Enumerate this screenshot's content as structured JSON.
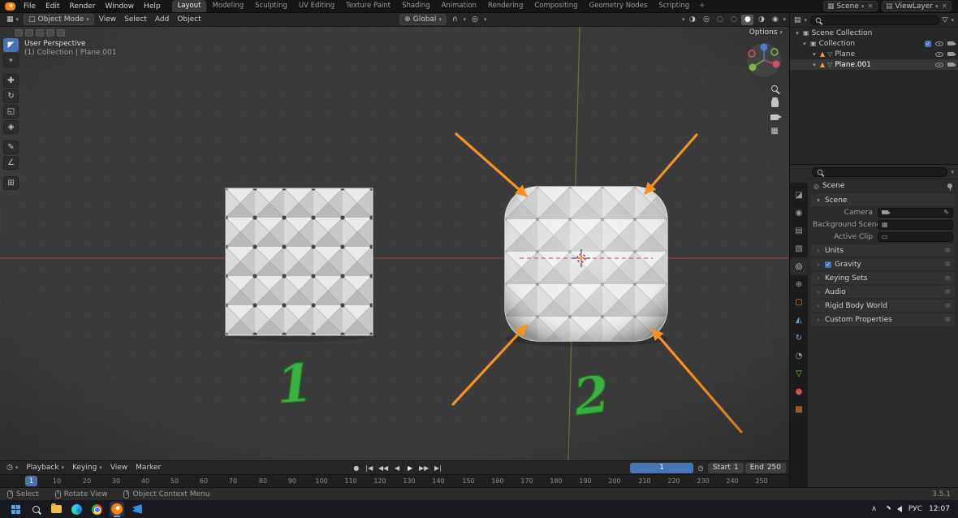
{
  "colors": {
    "accent_blue": "#4772b3",
    "arrow_orange": "#f7931e",
    "annotation_green": "#3cb043",
    "viewport_bg": "#3b3b3b"
  },
  "icons": {
    "dropdown": "▾",
    "close": "×",
    "expander_open": "▾",
    "collapsed": "›",
    "grid": "▦",
    "globe": "⊕",
    "magnet": "∩",
    "proportional": "◎",
    "wireframe": "◌",
    "solid": "●",
    "material_preview": "◑",
    "rendered": "◉",
    "record": "●",
    "jump_start": "|◀",
    "prev_key": "◀◀",
    "play_back": "◀",
    "play": "▶",
    "next_key": "▶▶",
    "jump_end": "▶|",
    "clock": "◷",
    "menu_lines": "≡",
    "check": "✓",
    "pencil": "✎",
    "scene": "◎",
    "viewlayer": "▤",
    "editor_outliner": "▤",
    "filter": "▽",
    "tray_chevron": "∧",
    "mesh_object": "▲",
    "mesh_data": "▽",
    "collection": "▣",
    "field_scene": "▦",
    "field_clip": "▭",
    "tools": [
      "◤",
      "⌖",
      "✚",
      "↻",
      "◱",
      "◈",
      "✎",
      "∠",
      "⊞"
    ],
    "ptabs": [
      "◪",
      "◉",
      "▤",
      "▧",
      "◎",
      "⊕",
      "▢",
      "◭",
      "↻",
      "◔",
      "▽",
      "●",
      "▩"
    ]
  },
  "topbar": {
    "menus": [
      "File",
      "Edit",
      "Render",
      "Window",
      "Help"
    ],
    "workspaces": [
      "Layout",
      "Modeling",
      "Sculpting",
      "UV Editing",
      "Texture Paint",
      "Shading",
      "Animation",
      "Rendering",
      "Compositing",
      "Geometry Nodes",
      "Scripting"
    ],
    "new_workspace": "+",
    "scene": "Scene",
    "viewlayer": "ViewLayer"
  },
  "viewport_header": {
    "mode": "Object Mode",
    "menus": [
      "View",
      "Select",
      "Add",
      "Object"
    ],
    "orientation": "Global",
    "options": "Options"
  },
  "viewport": {
    "perspective": "User Perspective",
    "context": "(1) Collection | Plane.001",
    "label_1": "1",
    "label_2": "2"
  },
  "outliner": {
    "scene_collection": "Scene Collection",
    "collection": "Collection",
    "plane": "Plane",
    "plane001": "Plane.001"
  },
  "properties": {
    "breadcrumb": "Scene",
    "scene_section": "Scene",
    "camera": "Camera",
    "background_scene": "Background Scene",
    "active_clip": "Active Clip",
    "sections": [
      "Units",
      "Gravity",
      "Keying Sets",
      "Audio",
      "Rigid Body World",
      "Custom Properties"
    ]
  },
  "timeline": {
    "menus": [
      "Playback",
      "Keying",
      "View",
      "Marker"
    ],
    "current_frame": "1",
    "start_label": "Start",
    "start_value": "1",
    "end_label": "End",
    "end_value": "250",
    "ticks": [
      "1",
      "10",
      "20",
      "30",
      "40",
      "50",
      "60",
      "70",
      "80",
      "90",
      "100",
      "110",
      "120",
      "130",
      "140",
      "150",
      "160",
      "170",
      "180",
      "190",
      "200",
      "210",
      "220",
      "230",
      "240",
      "250"
    ]
  },
  "statusbar": {
    "select": "Select",
    "rotate_view": "Rotate View",
    "context_menu": "Object Context Menu",
    "version": "3.5.1"
  },
  "taskbar": {
    "lang": "РУС",
    "time": "12:07"
  }
}
